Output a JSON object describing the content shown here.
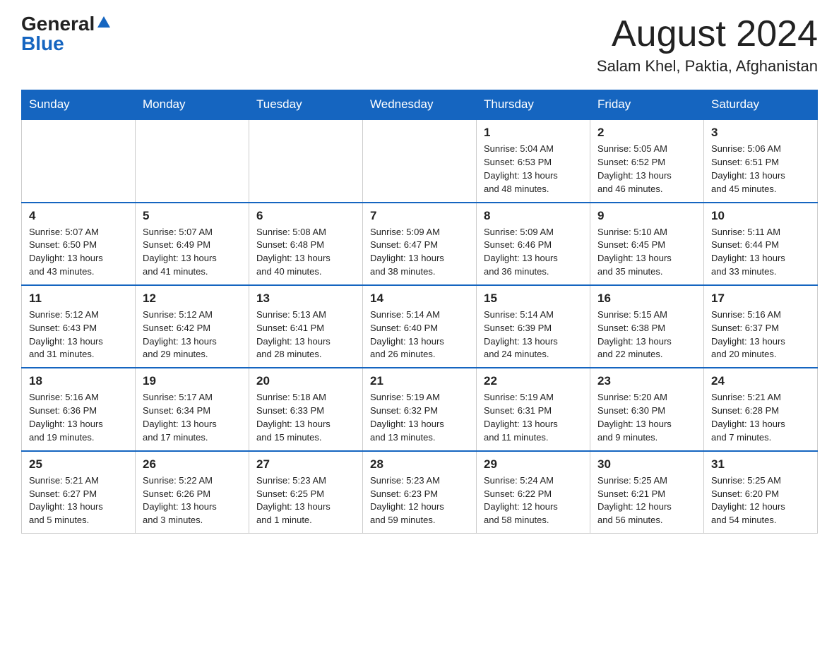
{
  "header": {
    "logo_general": "General",
    "logo_blue": "Blue",
    "month_title": "August 2024",
    "location": "Salam Khel, Paktia, Afghanistan"
  },
  "days_of_week": [
    "Sunday",
    "Monday",
    "Tuesday",
    "Wednesday",
    "Thursday",
    "Friday",
    "Saturday"
  ],
  "weeks": [
    [
      {
        "day": "",
        "info": ""
      },
      {
        "day": "",
        "info": ""
      },
      {
        "day": "",
        "info": ""
      },
      {
        "day": "",
        "info": ""
      },
      {
        "day": "1",
        "info": "Sunrise: 5:04 AM\nSunset: 6:53 PM\nDaylight: 13 hours\nand 48 minutes."
      },
      {
        "day": "2",
        "info": "Sunrise: 5:05 AM\nSunset: 6:52 PM\nDaylight: 13 hours\nand 46 minutes."
      },
      {
        "day": "3",
        "info": "Sunrise: 5:06 AM\nSunset: 6:51 PM\nDaylight: 13 hours\nand 45 minutes."
      }
    ],
    [
      {
        "day": "4",
        "info": "Sunrise: 5:07 AM\nSunset: 6:50 PM\nDaylight: 13 hours\nand 43 minutes."
      },
      {
        "day": "5",
        "info": "Sunrise: 5:07 AM\nSunset: 6:49 PM\nDaylight: 13 hours\nand 41 minutes."
      },
      {
        "day": "6",
        "info": "Sunrise: 5:08 AM\nSunset: 6:48 PM\nDaylight: 13 hours\nand 40 minutes."
      },
      {
        "day": "7",
        "info": "Sunrise: 5:09 AM\nSunset: 6:47 PM\nDaylight: 13 hours\nand 38 minutes."
      },
      {
        "day": "8",
        "info": "Sunrise: 5:09 AM\nSunset: 6:46 PM\nDaylight: 13 hours\nand 36 minutes."
      },
      {
        "day": "9",
        "info": "Sunrise: 5:10 AM\nSunset: 6:45 PM\nDaylight: 13 hours\nand 35 minutes."
      },
      {
        "day": "10",
        "info": "Sunrise: 5:11 AM\nSunset: 6:44 PM\nDaylight: 13 hours\nand 33 minutes."
      }
    ],
    [
      {
        "day": "11",
        "info": "Sunrise: 5:12 AM\nSunset: 6:43 PM\nDaylight: 13 hours\nand 31 minutes."
      },
      {
        "day": "12",
        "info": "Sunrise: 5:12 AM\nSunset: 6:42 PM\nDaylight: 13 hours\nand 29 minutes."
      },
      {
        "day": "13",
        "info": "Sunrise: 5:13 AM\nSunset: 6:41 PM\nDaylight: 13 hours\nand 28 minutes."
      },
      {
        "day": "14",
        "info": "Sunrise: 5:14 AM\nSunset: 6:40 PM\nDaylight: 13 hours\nand 26 minutes."
      },
      {
        "day": "15",
        "info": "Sunrise: 5:14 AM\nSunset: 6:39 PM\nDaylight: 13 hours\nand 24 minutes."
      },
      {
        "day": "16",
        "info": "Sunrise: 5:15 AM\nSunset: 6:38 PM\nDaylight: 13 hours\nand 22 minutes."
      },
      {
        "day": "17",
        "info": "Sunrise: 5:16 AM\nSunset: 6:37 PM\nDaylight: 13 hours\nand 20 minutes."
      }
    ],
    [
      {
        "day": "18",
        "info": "Sunrise: 5:16 AM\nSunset: 6:36 PM\nDaylight: 13 hours\nand 19 minutes."
      },
      {
        "day": "19",
        "info": "Sunrise: 5:17 AM\nSunset: 6:34 PM\nDaylight: 13 hours\nand 17 minutes."
      },
      {
        "day": "20",
        "info": "Sunrise: 5:18 AM\nSunset: 6:33 PM\nDaylight: 13 hours\nand 15 minutes."
      },
      {
        "day": "21",
        "info": "Sunrise: 5:19 AM\nSunset: 6:32 PM\nDaylight: 13 hours\nand 13 minutes."
      },
      {
        "day": "22",
        "info": "Sunrise: 5:19 AM\nSunset: 6:31 PM\nDaylight: 13 hours\nand 11 minutes."
      },
      {
        "day": "23",
        "info": "Sunrise: 5:20 AM\nSunset: 6:30 PM\nDaylight: 13 hours\nand 9 minutes."
      },
      {
        "day": "24",
        "info": "Sunrise: 5:21 AM\nSunset: 6:28 PM\nDaylight: 13 hours\nand 7 minutes."
      }
    ],
    [
      {
        "day": "25",
        "info": "Sunrise: 5:21 AM\nSunset: 6:27 PM\nDaylight: 13 hours\nand 5 minutes."
      },
      {
        "day": "26",
        "info": "Sunrise: 5:22 AM\nSunset: 6:26 PM\nDaylight: 13 hours\nand 3 minutes."
      },
      {
        "day": "27",
        "info": "Sunrise: 5:23 AM\nSunset: 6:25 PM\nDaylight: 13 hours\nand 1 minute."
      },
      {
        "day": "28",
        "info": "Sunrise: 5:23 AM\nSunset: 6:23 PM\nDaylight: 12 hours\nand 59 minutes."
      },
      {
        "day": "29",
        "info": "Sunrise: 5:24 AM\nSunset: 6:22 PM\nDaylight: 12 hours\nand 58 minutes."
      },
      {
        "day": "30",
        "info": "Sunrise: 5:25 AM\nSunset: 6:21 PM\nDaylight: 12 hours\nand 56 minutes."
      },
      {
        "day": "31",
        "info": "Sunrise: 5:25 AM\nSunset: 6:20 PM\nDaylight: 12 hours\nand 54 minutes."
      }
    ]
  ]
}
